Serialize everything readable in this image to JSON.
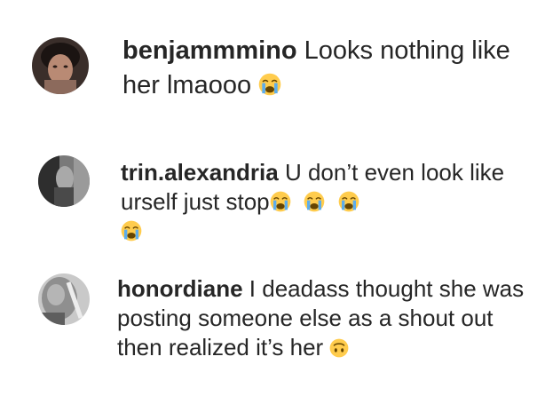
{
  "comments": [
    {
      "username": "benjammmino",
      "text": "Looks nothing like her lmaooo",
      "emojis": [
        "loudly-crying-face"
      ]
    },
    {
      "username": "trin.alexandria",
      "text": "U don’t even look like urself just stop",
      "emojis": [
        "loudly-crying-face",
        "loudly-crying-face",
        "loudly-crying-face",
        "loudly-crying-face"
      ]
    },
    {
      "username": "honordiane",
      "text": "I deadass thought she was posting someone else as a shout out then realized it’s her",
      "emojis": [
        "upside-down-face"
      ]
    }
  ],
  "colors": {
    "text": "#262626",
    "emoji_yellow": "#FFCC4D",
    "emoji_tears": "#5DADEC"
  }
}
